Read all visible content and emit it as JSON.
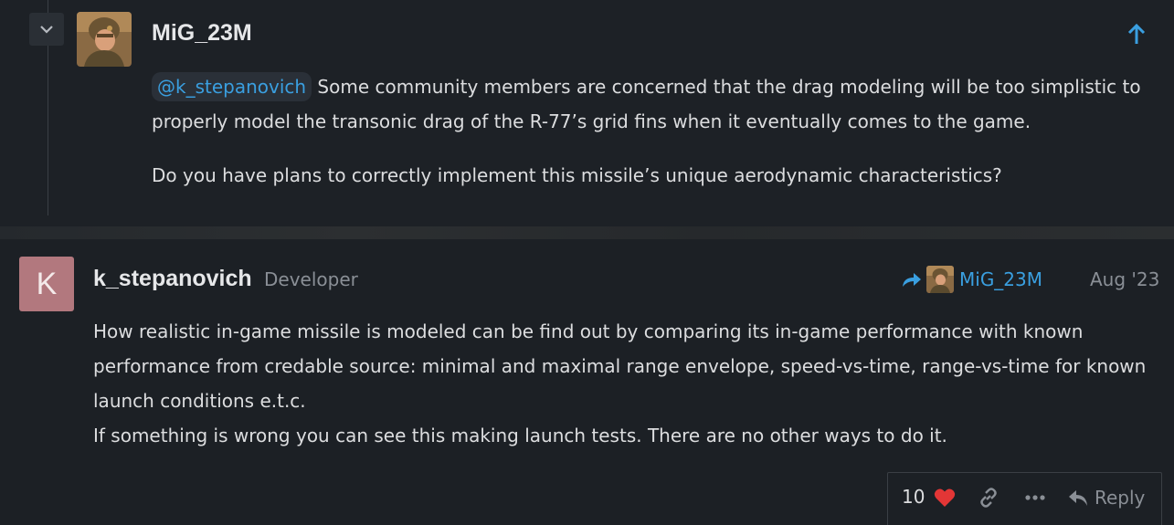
{
  "quoted_post": {
    "author": "MiG_23M",
    "mention": "@k_stepanovich",
    "text_line1": " Some community members are concerned that the drag modeling will be too simplistic to properly model the transonic drag of the R-77’s grid fins when it eventually comes to the game.",
    "paragraph2": "Do you have plans to correctly implement this missile’s unique aerodynamic characteristics?",
    "avatar_icon": "soldier-avatar"
  },
  "post": {
    "avatar_letter": "K",
    "author": "k_stepanovich",
    "role": "Developer",
    "reply_to": "MiG_23M",
    "date": "Aug '23",
    "body_line1": "How realistic in-game missile is modeled can be find out by comparing its in-game performance with known performance from credable source: minimal and maximal range envelope, speed-vs-time, range-vs-time for known launch conditions e.t.c.",
    "body_line2": "If something is wrong you can see this making launch tests. There are no other ways to do it."
  },
  "actions": {
    "like_count": "10",
    "reply_label": "Reply"
  },
  "colors": {
    "background": "#1c2025",
    "link": "#3a9fe0",
    "heart": "#e33636",
    "avatar_k": "#b2787e",
    "muted": "#8a8f96"
  }
}
